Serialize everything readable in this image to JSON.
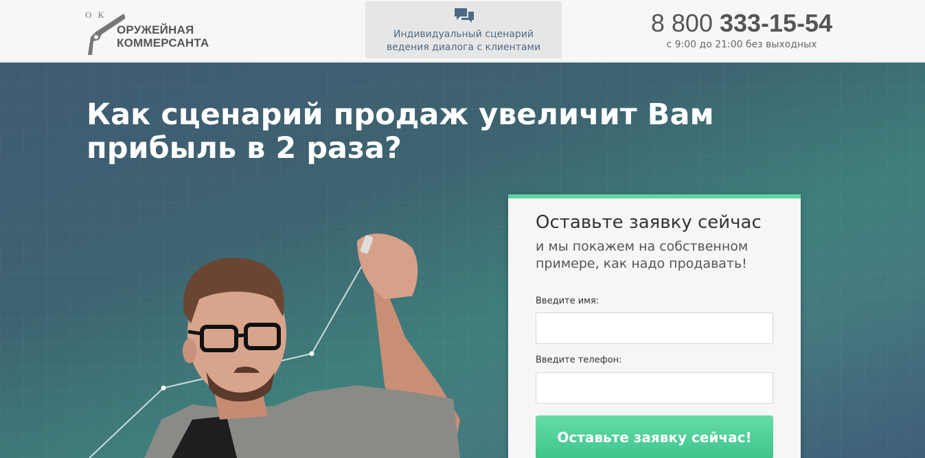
{
  "header": {
    "logo": {
      "letters": "О К",
      "line1": "ОРУЖЕЙНАЯ",
      "line2": "КОММЕРСАНТА"
    },
    "center_icon": "chat-bubbles-icon",
    "center_text_1": "Индивидуальный сценарий",
    "center_text_2": "ведения диалога с клиентами",
    "phone_prefix": "8 800 ",
    "phone_main": "333-15-54",
    "phone_hours": "с 9:00 до 21:00 без выходных"
  },
  "hero": {
    "title_line1": "Как сценарий продаж увеличит Вам",
    "title_line2": "прибыль в 2 раза?"
  },
  "form": {
    "title": "Оставьте заявку сейчас",
    "subtitle_line1": "и мы покажем на собственном",
    "subtitle_line2": "примере, как надо продавать!",
    "name_label": "Введите имя:",
    "name_value": "",
    "phone_label": "Введите телефон:",
    "phone_value": "",
    "submit_label": "Оставьте заявку сейчас!"
  },
  "colors": {
    "accent": "#5dd6a3",
    "header_text": "#4c6a84",
    "button": "#3fc48c"
  }
}
